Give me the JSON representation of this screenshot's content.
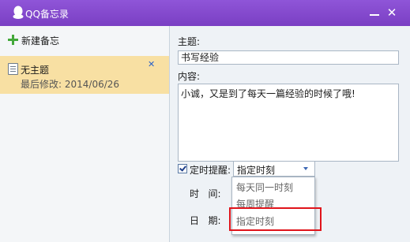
{
  "window": {
    "title": "QQ备忘录"
  },
  "sidebar": {
    "new_note_label": "新建备忘",
    "notes": [
      {
        "title": "无主题",
        "modified": "最后修改: 2014/06/26"
      }
    ]
  },
  "editor": {
    "subject_label": "主题:",
    "subject_value": "书写经验",
    "content_label": "内容:",
    "content_value": "小诚，又是到了每天一篇经验的时候了哦!",
    "reminder_label": "定时提醒:",
    "reminder_checked": true,
    "reminder_selected": "指定时刻",
    "time_label": "时   间:",
    "date_label": "日   期:"
  },
  "dropdown": {
    "options": [
      "每天同一时刻",
      "每周提醒",
      "指定时刻"
    ]
  },
  "colors": {
    "titlebar": "#7a3fc3",
    "selected_note": "#f8e0a3",
    "highlight": "#e0141b"
  },
  "icons": [
    "qq-logo-icon",
    "minimize-icon",
    "close-icon",
    "plus-icon",
    "document-icon",
    "checkbox-icon",
    "dropdown-arrow-icon"
  ]
}
